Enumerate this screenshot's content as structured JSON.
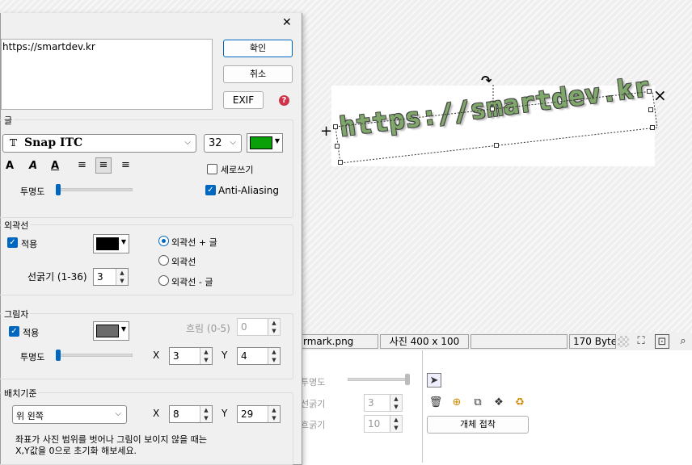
{
  "canvas": {
    "watermark_text": "https://smartdev.kr",
    "rotate_icon": "rotate-icon",
    "close_glyph": "×",
    "move_glyph": "+"
  },
  "status_bar": {
    "filename": "rmark.png",
    "size": "사진 400 x 100",
    "empty": "",
    "bytes": "170 Bytes"
  },
  "bottom_panel": {
    "opacity_label": "투명도",
    "line_label": "선굵기",
    "line_value": "3",
    "blur_label": "흐굵기",
    "blur_value": "10",
    "attach_button": "개체 접착"
  },
  "dialog": {
    "close_glyph": "✕",
    "text_input": "https://smartdev.kr",
    "ok_button": "확인",
    "cancel_button": "취소",
    "exif_button": "EXIF",
    "help_glyph": "?",
    "font_group": {
      "title": "글",
      "font_name": "Snap ITC",
      "font_size": "32",
      "color": "#0aa00a",
      "vertical_label": "세로쓰기",
      "vertical_checked": false,
      "antialias_label": "Anti-Aliasing",
      "antialias_checked": true,
      "opacity_label": "투명도",
      "opacity_value": 0
    },
    "outline_group": {
      "title": "외곽선",
      "apply_label": "적용",
      "apply_checked": true,
      "color": "#000000",
      "thickness_label": "선굵기 (1-36)",
      "thickness_value": "3",
      "options": [
        "외곽선 + 글",
        "외곽선",
        "외곽선 - 글"
      ],
      "selected": 0
    },
    "shadow_group": {
      "title": "그림자",
      "apply_label": "적용",
      "apply_checked": true,
      "color": "#6b6b6b",
      "blur_label": "흐림 (0-5)",
      "blur_value": "0",
      "opacity_label": "투명도",
      "x_label": "X",
      "x_value": "3",
      "y_label": "Y",
      "y_value": "4"
    },
    "position_group": {
      "title": "배치기준",
      "anchor": "위 왼쪽",
      "x_label": "X",
      "x_value": "8",
      "y_label": "Y",
      "y_value": "29",
      "note_line1": "좌표가 사진 범위를 벗어나 그림이 보이지 않을 때는",
      "note_line2": "X,Y값을 0으로 초기화 해보세요."
    }
  }
}
